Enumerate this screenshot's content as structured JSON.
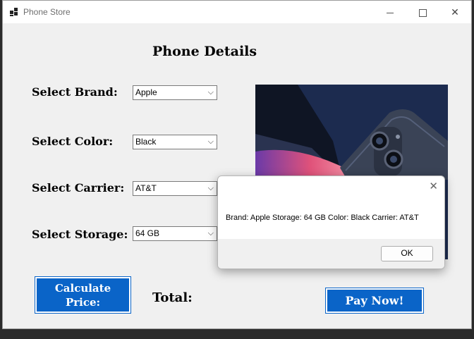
{
  "window": {
    "title": "Phone Store",
    "controls": {
      "minimize": "minimize-icon",
      "maximize": "maximize-icon",
      "close": "close-icon"
    }
  },
  "form": {
    "heading": "Phone Details",
    "fields": [
      {
        "label": "Select Brand:",
        "value": "Apple"
      },
      {
        "label": "Select Color:",
        "value": "Black"
      },
      {
        "label": "Select Carrier:",
        "value": "AT&T"
      },
      {
        "label": "Select Storage:",
        "value": "64 GB"
      }
    ],
    "calculate_label": "Calculate Price:",
    "total_label": "Total:",
    "pay_label": "Pay Now!"
  },
  "dialog": {
    "message": "Brand: Apple Storage: 64 GB Color: Black Carrier: AT&T",
    "ok_label": "OK"
  },
  "colors": {
    "button_blue": "#0a64c8",
    "image_bg": "#1c2b4f"
  }
}
